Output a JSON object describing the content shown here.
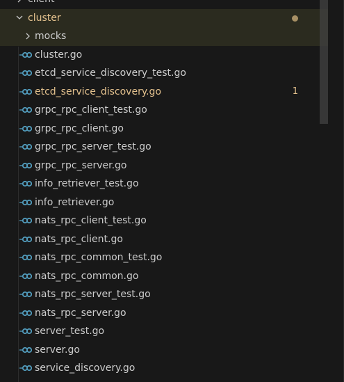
{
  "explorer": {
    "items": [
      {
        "label": "client",
        "kind": "folder",
        "expanded": false
      },
      {
        "label": "cluster",
        "kind": "folder",
        "expanded": true,
        "status": "modified"
      },
      {
        "label": "mocks",
        "kind": "folder",
        "expanded": false
      }
    ],
    "files": [
      {
        "name": "cluster.go"
      },
      {
        "name": "etcd_service_discovery_test.go"
      },
      {
        "name": "etcd_service_discovery.go",
        "status": "modified",
        "problems": "1"
      },
      {
        "name": "grpc_rpc_client_test.go"
      },
      {
        "name": "grpc_rpc_client.go"
      },
      {
        "name": "grpc_rpc_server_test.go"
      },
      {
        "name": "grpc_rpc_server.go"
      },
      {
        "name": "info_retriever_test.go"
      },
      {
        "name": "info_retriever.go"
      },
      {
        "name": "nats_rpc_client_test.go"
      },
      {
        "name": "nats_rpc_client.go"
      },
      {
        "name": "nats_rpc_common_test.go"
      },
      {
        "name": "nats_rpc_common.go"
      },
      {
        "name": "nats_rpc_server_test.go"
      },
      {
        "name": "nats_rpc_server.go"
      },
      {
        "name": "server_test.go"
      },
      {
        "name": "server.go"
      },
      {
        "name": "service_discovery.go"
      }
    ]
  },
  "colors": {
    "background": "#181818",
    "modified": "#e2c08d",
    "go_icon": "#519aba",
    "text": "#cccccc"
  },
  "icons": {
    "folder_collapsed": "chevron-right-icon",
    "folder_expanded": "chevron-down-icon",
    "go_file": "go-file-icon"
  }
}
